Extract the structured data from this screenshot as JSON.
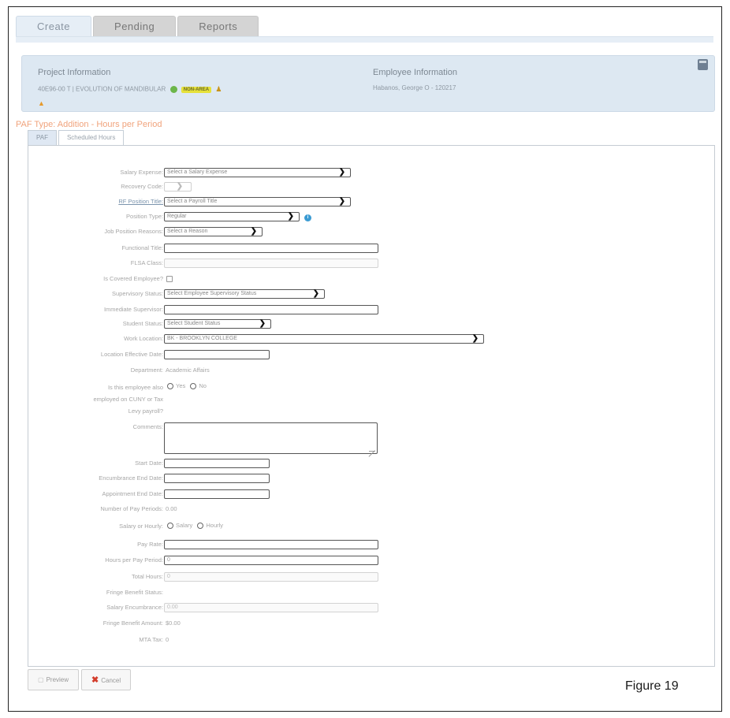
{
  "tabs": [
    "Create",
    "Pending",
    "Reports"
  ],
  "project": {
    "title": "Project Information",
    "line": "40E96-00 T | EVOLUTION OF MANDIBULAR",
    "badge": "NON-AREA"
  },
  "employee": {
    "title": "Employee Information",
    "name": "Habanos, George O - 120217"
  },
  "paf_type": "PAF Type: Addition - Hours per Period",
  "subtabs": [
    "PAF",
    "Scheduled Hours"
  ],
  "form": {
    "salary_expense": {
      "label": "Salary Expense:",
      "value": "Select a Salary Expense"
    },
    "recovery_code": {
      "label": "Recovery Code:"
    },
    "rf_position_title": {
      "label": "RF Position Title:",
      "value": "Select a Payroll Title"
    },
    "position_type": {
      "label": "Position Type:",
      "value": "Regular"
    },
    "job_position_reasons": {
      "label": "Job Position Reasons:",
      "value": "Select a Reason"
    },
    "functional_title": {
      "label": "Functional Title:"
    },
    "flsa_class": {
      "label": "FLSA Class:"
    },
    "is_covered_employee": {
      "label": "Is Covered Employee?"
    },
    "supervisory_status": {
      "label": "Supervisory Status:",
      "value": "Select Employee Supervisory Status"
    },
    "immediate_supervisor": {
      "label": "Immediate Supervisor:"
    },
    "student_status": {
      "label": "Student Status:",
      "value": "Select Student Status"
    },
    "work_location": {
      "label": "Work Location:",
      "value": "BK - BROOKLYN COLLEGE"
    },
    "location_effective_date": {
      "label": "Location Effective Date:"
    },
    "department": {
      "label": "Department:",
      "value": "Academic Affairs"
    },
    "also_employed": {
      "label_lines": [
        "Is this employee also",
        "employed on CUNY or Tax",
        "Levy payroll?"
      ],
      "options": [
        "Yes",
        "No"
      ]
    },
    "comments": {
      "label": "Comments:"
    },
    "start_date": {
      "label": "Start Date:"
    },
    "encumbrance_end_date": {
      "label": "Encumbrance End Date:"
    },
    "appointment_end_date": {
      "label": "Appointment End Date:"
    },
    "number_of_pay_periods": {
      "label": "Number of Pay Periods:",
      "value": "0.00"
    },
    "salary_or_hourly": {
      "label": "Salary or Hourly:",
      "options": [
        "Salary",
        "Hourly"
      ]
    },
    "pay_rate": {
      "label": "Pay Rate:"
    },
    "hours_per_pay_period": {
      "label": "Hours per Pay Period:",
      "value": "0"
    },
    "total_hours": {
      "label": "Total Hours:",
      "value": "0"
    },
    "fringe_benefit_status": {
      "label": "Fringe Benefit Status:"
    },
    "salary_encumbrance": {
      "label": "Salary Encumbrance:",
      "value": "0.00"
    },
    "fringe_benefit_amount": {
      "label": "Fringe Benefit Amount:",
      "value": "$0.00"
    },
    "mta_tax": {
      "label": "MTA Tax:",
      "value": "0"
    }
  },
  "footer": {
    "preview": "Preview",
    "cancel": "Cancel"
  },
  "caption": "Figure 19",
  "colors": {
    "accent": "#f0a37c",
    "panel_bg": "#dde8f2",
    "status_green": "#6cb64a",
    "badge_yellow": "#e6e13a",
    "cancel_red": "#d33c2b"
  },
  "icons": [
    "calculator-icon",
    "status-check-icon",
    "person-icon",
    "flame-icon",
    "info-icon",
    "chevron-down-icon",
    "preview-icon",
    "close-icon"
  ]
}
